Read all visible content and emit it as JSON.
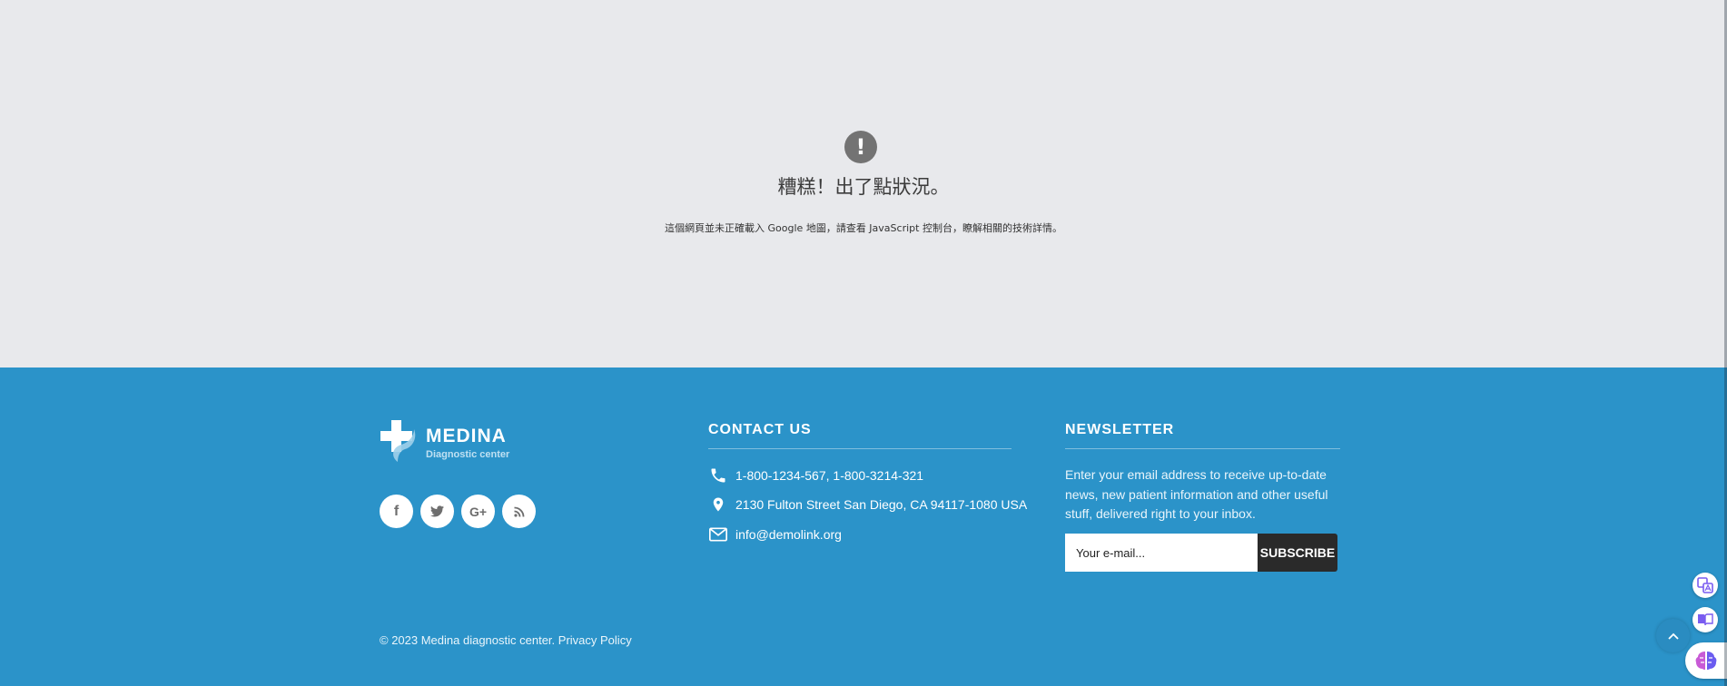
{
  "map_error": {
    "icon": "exclamation-icon",
    "icon_glyph": "!",
    "title": "糟糕！出了點狀況。",
    "description": "這個網頁並未正確載入 Google 地圖，請查看 JavaScript 控制台，瞭解相關的技術詳情。"
  },
  "footer": {
    "logo": {
      "title": "MEDINA",
      "subtitle": "Diagnostic center"
    },
    "socials": [
      {
        "name": "facebook-icon",
        "glyph": "f"
      },
      {
        "name": "twitter-icon",
        "glyph": ""
      },
      {
        "name": "google-plus-icon",
        "glyph": "G+"
      },
      {
        "name": "rss-icon",
        "glyph": ""
      }
    ],
    "contact": {
      "title": "CONTACT US",
      "phone": "1-800-1234-567, 1-800-3214-321",
      "address": "2130 Fulton Street San Diego, CA 94117-1080 USA",
      "email": "info@demolink.org"
    },
    "newsletter": {
      "title": "NEWSLETTER",
      "text": "Enter your email address to receive up-to-date news, new patient information and other useful stuff, delivered right to your inbox.",
      "placeholder": "Your e-mail...",
      "button": "SUBSCRIBE"
    },
    "copyright": "© 2023 Medina diagnostic center.",
    "privacy": "Privacy Policy"
  },
  "colors": {
    "footer_bg": "#2b93c9",
    "map_bg": "#e8e9ec",
    "button_bg": "#2a2a2a"
  }
}
